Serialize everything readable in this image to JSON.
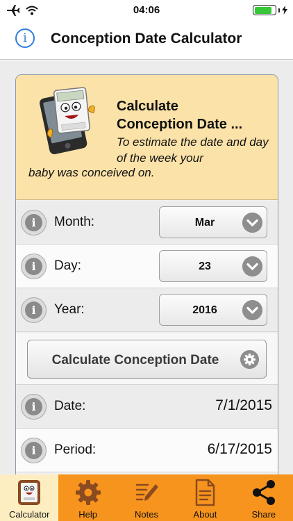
{
  "status": {
    "time": "04:06",
    "battery_percent": 85
  },
  "nav": {
    "info_symbol": "i",
    "title": "Conception Date Calculator"
  },
  "header": {
    "title_line1": "Calculate",
    "title_line2": "Conception Date ...",
    "subtitle_line1": "To estimate the date and day of the week your",
    "subtitle_line2": "baby was conceived on."
  },
  "form": {
    "month": {
      "label": "Month:",
      "value": "Mar"
    },
    "day": {
      "label": "Day:",
      "value": "23"
    },
    "year": {
      "label": "Year:",
      "value": "2016"
    }
  },
  "calculate_button": "Calculate Conception Date",
  "results": {
    "date": {
      "label": "Date:",
      "value": "7/1/2015"
    },
    "period": {
      "label": "Period:",
      "value": "6/17/2015"
    }
  },
  "info_symbol": "i",
  "tabs": [
    {
      "label": "Calculator",
      "icon": "calculator-mascot-icon",
      "active": true
    },
    {
      "label": "Help",
      "icon": "gear-icon",
      "active": false
    },
    {
      "label": "Notes",
      "icon": "notes-icon",
      "active": false
    },
    {
      "label": "About",
      "icon": "document-icon",
      "active": false
    },
    {
      "label": "Share",
      "icon": "share-icon",
      "active": false
    }
  ],
  "colors": {
    "accent_blue": "#2e7de0",
    "header_bg": "#fbe2a8",
    "tab_bar_bg": "#f7941d",
    "tab_active_bg": "#fdeec2",
    "tab_icon_brown": "#8b4a1f"
  }
}
